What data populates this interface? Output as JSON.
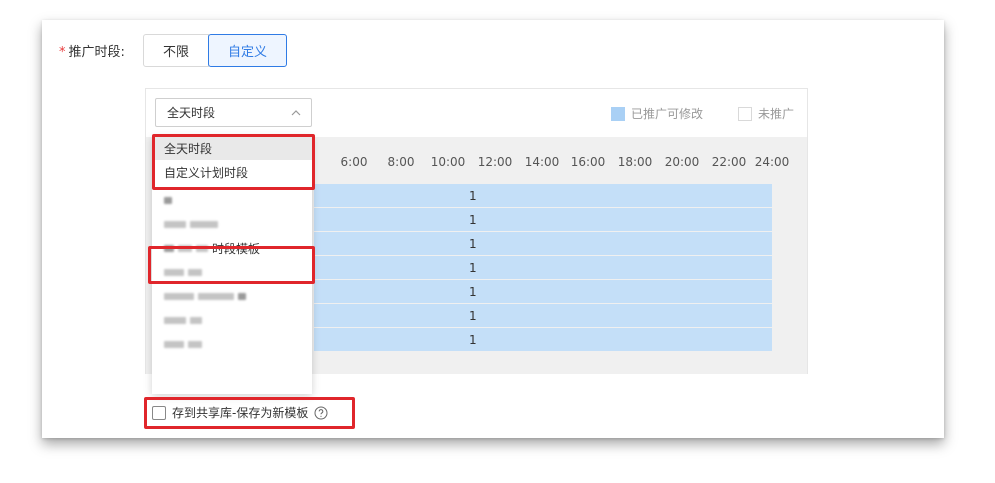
{
  "form": {
    "required_mark": "*",
    "label": "推广时段:",
    "options": [
      "不限",
      "自定义"
    ],
    "selected_option": "自定义"
  },
  "schedule": {
    "select_value": "全天时段",
    "legend": {
      "edited_label": "已推广可修改",
      "edited_color": "#a9d0f5",
      "none_label": "未推广"
    },
    "hours": [
      "6:00",
      "8:00",
      "10:00",
      "12:00",
      "14:00",
      "16:00",
      "18:00",
      "20:00",
      "22:00",
      "24:00"
    ],
    "rows": [
      "1",
      "1",
      "1",
      "1",
      "1",
      "1",
      "1"
    ]
  },
  "dropdown": {
    "items": [
      {
        "label": "全天时段",
        "selected": true
      },
      {
        "label": "自定义计划时段",
        "selected": false
      },
      {
        "label": "",
        "blurred": true
      },
      {
        "label": "",
        "blurred": true
      },
      {
        "label": "时段模板",
        "blurred_prefix": true
      },
      {
        "label": "",
        "blurred": true
      },
      {
        "label": "",
        "blurred": true
      },
      {
        "label": "",
        "blurred": true
      },
      {
        "label": "",
        "blurred": true
      }
    ]
  },
  "save": {
    "label": "存到共享库-保存为新模板",
    "checked": false
  },
  "colors": {
    "accent": "#2f7be5",
    "highlight_box": "#e0262b",
    "band": "#c4dff8"
  }
}
